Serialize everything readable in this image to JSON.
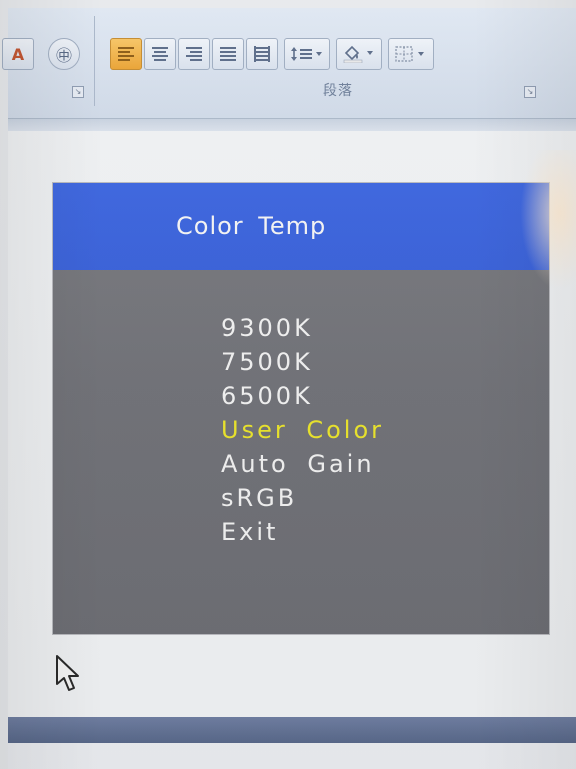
{
  "ribbon": {
    "group_label": "段落",
    "launcher_glyph": "↘",
    "buttons": [
      {
        "icon": "align-left-icon"
      },
      {
        "icon": "align-center-icon"
      },
      {
        "icon": "align-right-icon"
      },
      {
        "icon": "justify-icon"
      },
      {
        "icon": "distribute-icon"
      },
      {
        "icon": "line-spacing-icon"
      },
      {
        "icon": "shading-icon"
      },
      {
        "icon": "borders-icon"
      }
    ]
  },
  "osd": {
    "title": "Color Temp",
    "menu_items": [
      {
        "label": "9300K",
        "selected": false
      },
      {
        "label": "7500K",
        "selected": false
      },
      {
        "label": "6500K",
        "selected": false
      },
      {
        "label": "User Color",
        "selected": true
      },
      {
        "label": "Auto Gain",
        "selected": false
      },
      {
        "label": "sRGB",
        "selected": false
      },
      {
        "label": "Exit",
        "selected": false
      }
    ],
    "colors": {
      "header": "#3b64de",
      "body": "#717277",
      "text": "#efefef",
      "selected": "#e8e22a"
    }
  }
}
